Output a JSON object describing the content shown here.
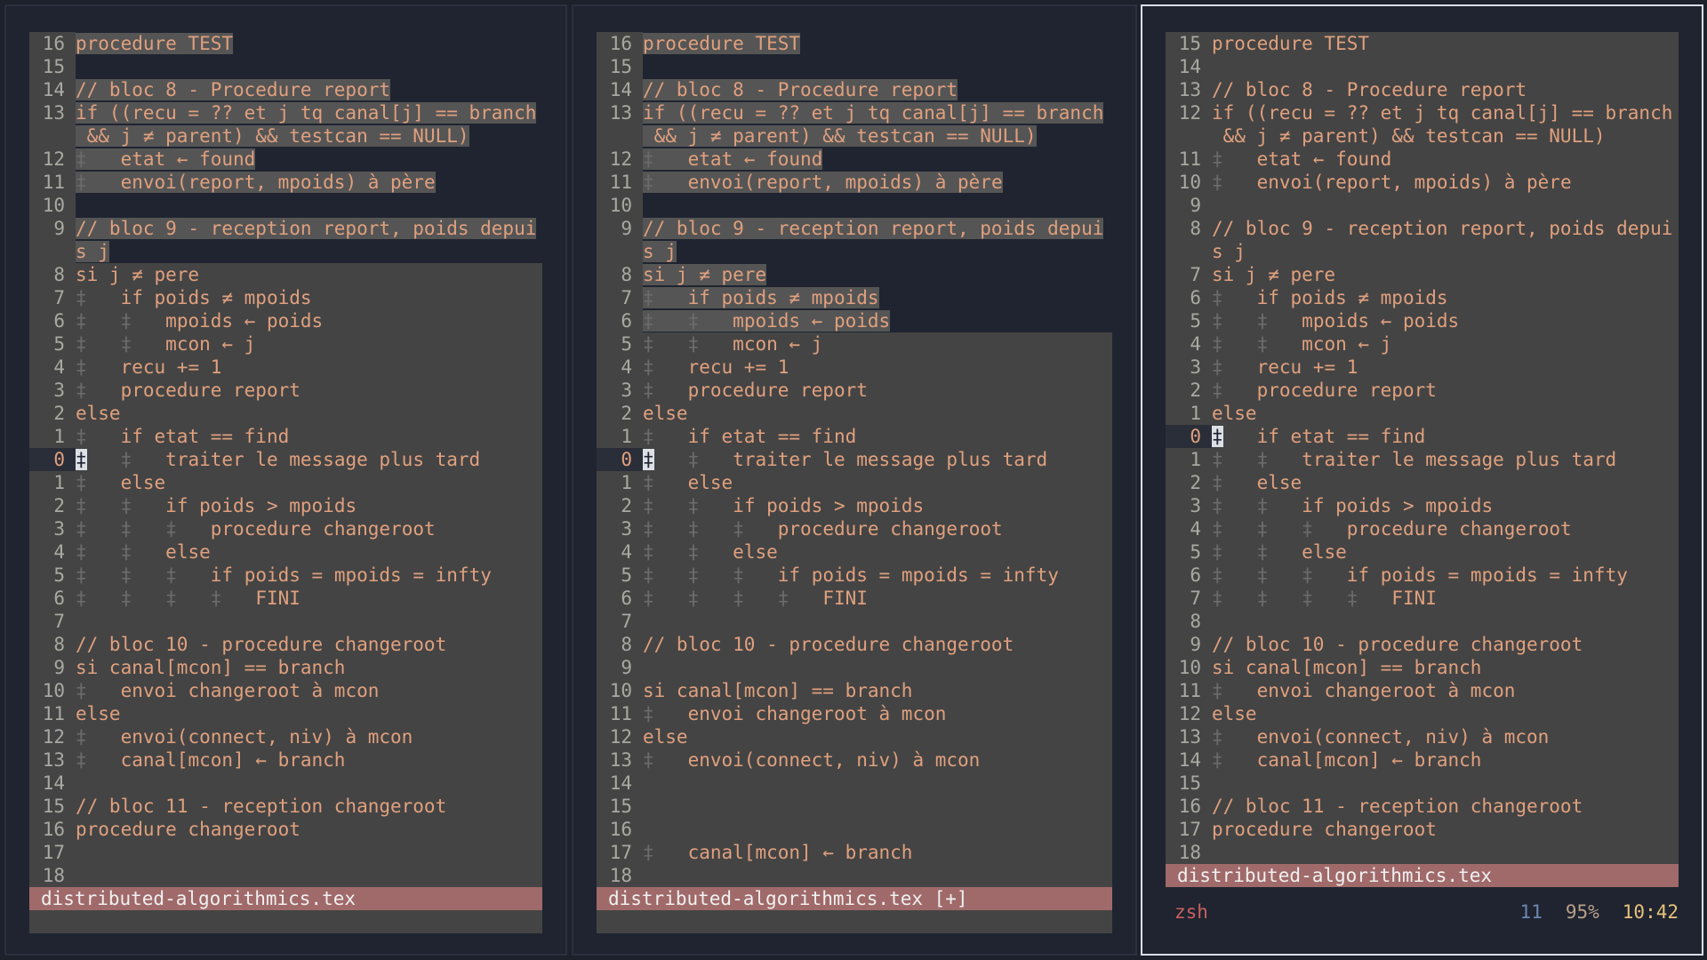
{
  "panes": [
    {
      "name": "left",
      "active": false,
      "status_label": "distributed-algorithmics.tex",
      "lines": [
        {
          "n": "16",
          "t": "procedure TEST",
          "hl": true
        },
        {
          "n": "15",
          "t": "",
          "dark": true
        },
        {
          "n": "14",
          "t": "// bloc 8 - Procedure report",
          "hl": true
        },
        {
          "n": "13",
          "t": "if ((recu = ?? et j tq canal[j] == branch",
          "hl": true
        },
        {
          "n": "",
          "t": " && j ≠ parent) && testcan == NULL)",
          "hl": true
        },
        {
          "n": "12",
          "t": "‡   etat ← found",
          "hl": true
        },
        {
          "n": "11",
          "t": "‡   envoi(report, mpoids) à père",
          "hl": true
        },
        {
          "n": "10",
          "t": "",
          "dark": true
        },
        {
          "n": "9",
          "t": "// bloc 9 - reception report, poids depui",
          "hl": true
        },
        {
          "n": "",
          "t": "s j",
          "hl": true
        },
        {
          "n": "8",
          "t": "si j ≠ pere"
        },
        {
          "n": "7",
          "t": "‡   if poids ≠ mpoids"
        },
        {
          "n": "6",
          "t": "‡   ‡   mpoids ← poids"
        },
        {
          "n": "5",
          "t": "‡   ‡   mcon ← j"
        },
        {
          "n": "4",
          "t": "‡   recu += 1"
        },
        {
          "n": "3",
          "t": "‡   procedure report"
        },
        {
          "n": "2",
          "t": "else"
        },
        {
          "n": "1",
          "t": "‡   if etat == find"
        },
        {
          "n": "0",
          "t": "‡   ‡   traiter le message plus tard",
          "cur": true
        },
        {
          "n": "1",
          "t": "‡   else"
        },
        {
          "n": "2",
          "t": "‡   ‡   if poids > mpoids"
        },
        {
          "n": "3",
          "t": "‡   ‡   ‡   procedure changeroot"
        },
        {
          "n": "4",
          "t": "‡   ‡   else"
        },
        {
          "n": "5",
          "t": "‡   ‡   ‡   if poids = mpoids = infty"
        },
        {
          "n": "6",
          "t": "‡   ‡   ‡   ‡   FINI"
        },
        {
          "n": "7",
          "t": ""
        },
        {
          "n": "8",
          "t": "// bloc 10 - procedure changeroot"
        },
        {
          "n": "9",
          "t": "si canal[mcon] == branch"
        },
        {
          "n": "10",
          "t": "‡   envoi changeroot à mcon"
        },
        {
          "n": "11",
          "t": "else"
        },
        {
          "n": "12",
          "t": "‡   envoi(connect, niv) à mcon"
        },
        {
          "n": "13",
          "t": "‡   canal[mcon] ← branch"
        },
        {
          "n": "14",
          "t": ""
        },
        {
          "n": "15",
          "t": "// bloc 11 - reception changeroot"
        },
        {
          "n": "16",
          "t": "procedure changeroot"
        },
        {
          "n": "17",
          "t": ""
        },
        {
          "n": "18",
          "t": ""
        }
      ]
    },
    {
      "name": "middle",
      "active": false,
      "status_label": "distributed-algorithmics.tex [+]",
      "lines": [
        {
          "n": "16",
          "t": "procedure TEST",
          "hl": true
        },
        {
          "n": "15",
          "t": "",
          "dark": true
        },
        {
          "n": "14",
          "t": "// bloc 8 - Procedure report",
          "hl": true
        },
        {
          "n": "13",
          "t": "if ((recu = ?? et j tq canal[j] == branch",
          "hl": true
        },
        {
          "n": "",
          "t": " && j ≠ parent) && testcan == NULL)",
          "hl": true
        },
        {
          "n": "12",
          "t": "‡   etat ← found",
          "hl": true
        },
        {
          "n": "11",
          "t": "‡   envoi(report, mpoids) à père",
          "hl": true
        },
        {
          "n": "10",
          "t": "",
          "dark": true
        },
        {
          "n": "9",
          "t": "// bloc 9 - reception report, poids depui",
          "hl": true
        },
        {
          "n": "",
          "t": "s j",
          "hl": true
        },
        {
          "n": "8",
          "t": "si j ≠ pere",
          "hl": true
        },
        {
          "n": "7",
          "t": "‡   if poids ≠ mpoids",
          "hl": true
        },
        {
          "n": "6",
          "t": "‡   ‡   mpoids ← poids",
          "hl": true
        },
        {
          "n": "5",
          "t": "‡   ‡   mcon ← j"
        },
        {
          "n": "4",
          "t": "‡   recu += 1"
        },
        {
          "n": "3",
          "t": "‡   procedure report"
        },
        {
          "n": "2",
          "t": "else"
        },
        {
          "n": "1",
          "t": "‡   if etat == find"
        },
        {
          "n": "0",
          "t": "‡   ‡   traiter le message plus tard",
          "cur": true
        },
        {
          "n": "1",
          "t": "‡   else"
        },
        {
          "n": "2",
          "t": "‡   ‡   if poids > mpoids"
        },
        {
          "n": "3",
          "t": "‡   ‡   ‡   procedure changeroot"
        },
        {
          "n": "4",
          "t": "‡   ‡   else"
        },
        {
          "n": "5",
          "t": "‡   ‡   ‡   if poids = mpoids = infty"
        },
        {
          "n": "6",
          "t": "‡   ‡   ‡   ‡   FINI"
        },
        {
          "n": "7",
          "t": ""
        },
        {
          "n": "8",
          "t": "// bloc 10 - procedure changeroot"
        },
        {
          "n": "9",
          "t": ""
        },
        {
          "n": "10",
          "t": "si canal[mcon] == branch"
        },
        {
          "n": "11",
          "t": "‡   envoi changeroot à mcon"
        },
        {
          "n": "12",
          "t": "else"
        },
        {
          "n": "13",
          "t": "‡   envoi(connect, niv) à mcon"
        },
        {
          "n": "14",
          "t": ""
        },
        {
          "n": "15",
          "t": ""
        },
        {
          "n": "16",
          "t": ""
        },
        {
          "n": "17",
          "t": "‡   canal[mcon] ← branch"
        },
        {
          "n": "18",
          "t": ""
        }
      ]
    },
    {
      "name": "right",
      "active": true,
      "status_label": "distributed-algorithmics.tex",
      "lines": [
        {
          "n": "15",
          "t": "procedure TEST"
        },
        {
          "n": "14",
          "t": ""
        },
        {
          "n": "13",
          "t": "// bloc 8 - Procedure report"
        },
        {
          "n": "12",
          "t": "if ((recu = ?? et j tq canal[j] == branch"
        },
        {
          "n": "",
          "t": " && j ≠ parent) && testcan == NULL)"
        },
        {
          "n": "11",
          "t": "‡   etat ← found"
        },
        {
          "n": "10",
          "t": "‡   envoi(report, mpoids) à père"
        },
        {
          "n": "9",
          "t": ""
        },
        {
          "n": "8",
          "t": "// bloc 9 - reception report, poids depui"
        },
        {
          "n": "",
          "t": "s j"
        },
        {
          "n": "7",
          "t": "si j ≠ pere"
        },
        {
          "n": "6",
          "t": "‡   if poids ≠ mpoids"
        },
        {
          "n": "5",
          "t": "‡   ‡   mpoids ← poids"
        },
        {
          "n": "4",
          "t": "‡   ‡   mcon ← j"
        },
        {
          "n": "3",
          "t": "‡   recu += 1"
        },
        {
          "n": "2",
          "t": "‡   procedure report"
        },
        {
          "n": "1",
          "t": "else"
        },
        {
          "n": "0",
          "t": "‡   if etat == find",
          "cur": true
        },
        {
          "n": "1",
          "t": "‡   ‡   traiter le message plus tard"
        },
        {
          "n": "2",
          "t": "‡   else"
        },
        {
          "n": "3",
          "t": "‡   ‡   if poids > mpoids"
        },
        {
          "n": "4",
          "t": "‡   ‡   ‡   procedure changeroot"
        },
        {
          "n": "5",
          "t": "‡   ‡   else"
        },
        {
          "n": "6",
          "t": "‡   ‡   ‡   if poids = mpoids = infty"
        },
        {
          "n": "7",
          "t": "‡   ‡   ‡   ‡   FINI"
        },
        {
          "n": "8",
          "t": ""
        },
        {
          "n": "9",
          "t": "// bloc 10 - procedure changeroot"
        },
        {
          "n": "10",
          "t": "si canal[mcon] == branch"
        },
        {
          "n": "11",
          "t": "‡   envoi changeroot à mcon"
        },
        {
          "n": "12",
          "t": "else"
        },
        {
          "n": "13",
          "t": "‡   envoi(connect, niv) à mcon"
        },
        {
          "n": "14",
          "t": "‡   canal[mcon] ← branch"
        },
        {
          "n": "15",
          "t": ""
        },
        {
          "n": "16",
          "t": "// bloc 11 - reception changeroot"
        },
        {
          "n": "17",
          "t": "procedure changeroot"
        },
        {
          "n": "18",
          "t": ""
        }
      ]
    }
  ],
  "tmux": {
    "session": "zsh",
    "window": "11",
    "percent": "95%",
    "time": "10:42"
  },
  "colors": {
    "background": "#1f2430",
    "editor_bg": "#444444",
    "text": "#e0a07e",
    "status_bar": "#a06a6a",
    "active_border": "#d8dde6"
  }
}
